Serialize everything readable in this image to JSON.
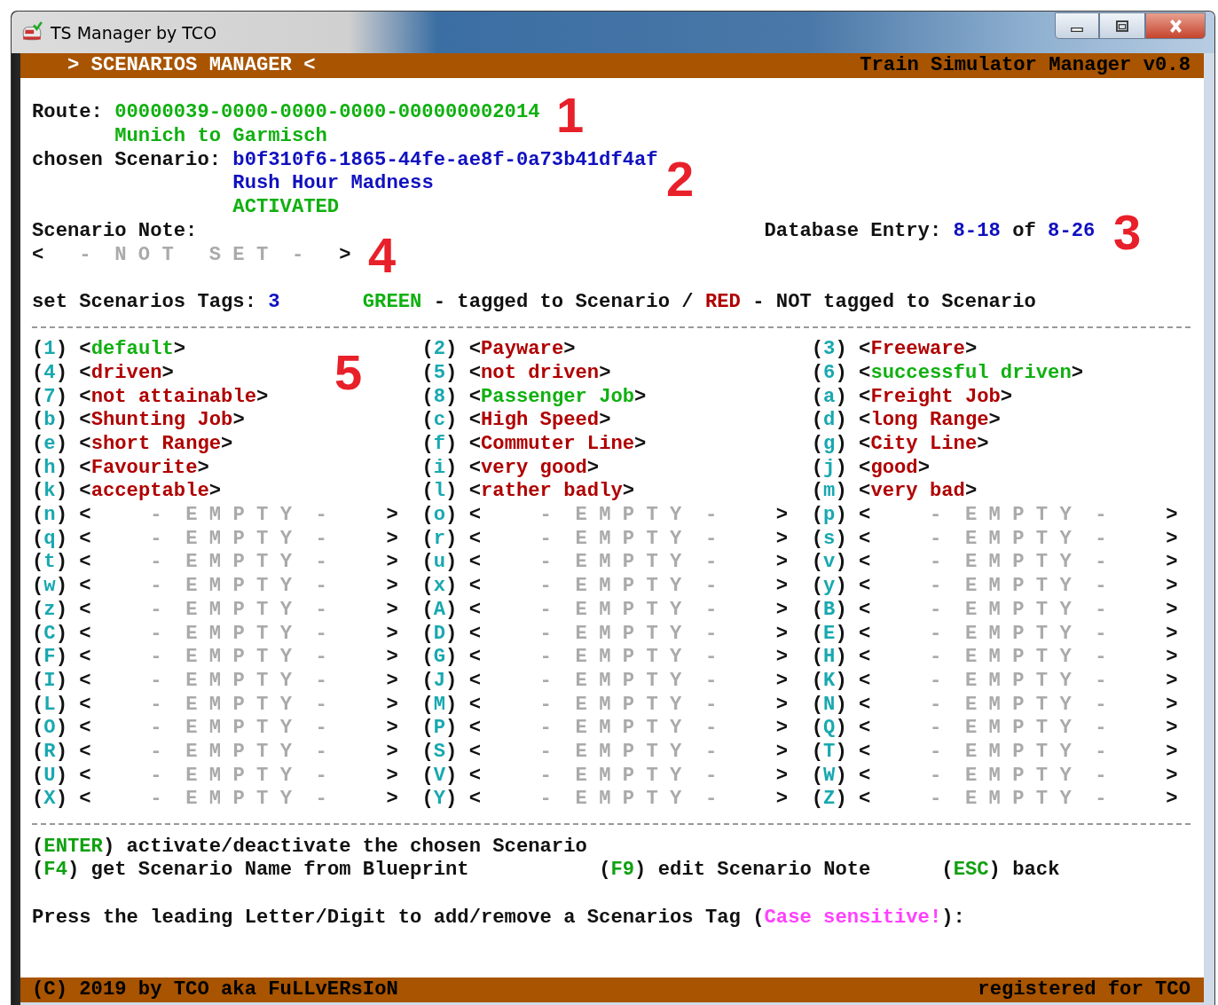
{
  "window": {
    "title": "TS Manager by TCO"
  },
  "header": {
    "left": "> SCENARIOS MANAGER <",
    "right": "Train Simulator Manager v0.8"
  },
  "route": {
    "label": "Route:",
    "id": "00000039-0000-0000-0000-000000002014",
    "name": "Munich to Garmisch"
  },
  "scenario": {
    "label": "chosen Scenario:",
    "id": "b0f310f6-1865-44fe-ae8f-0a73b41df4af",
    "name": "Rush Hour Madness",
    "status": "ACTIVATED",
    "activated": true
  },
  "note": {
    "label": "Scenario Note:",
    "open": "<",
    "text": "-  N O T   S E T  -",
    "close": ">",
    "set": false
  },
  "database": {
    "label": "Database Entry:",
    "current": "8-18",
    "of": "of",
    "total": "8-26"
  },
  "tags": {
    "label": "set Scenarios Tags:",
    "count": "3",
    "legend": [
      {
        "text": "GREEN",
        "kind": "ok"
      },
      {
        "text": " - tagged to Scenario / ",
        "kind": "plain"
      },
      {
        "text": "RED",
        "kind": "bad"
      },
      {
        "text": " - NOT tagged to Scenario",
        "kind": "plain"
      }
    ],
    "items": [
      {
        "key": [
          "(",
          "1",
          ")"
        ],
        "label": [
          "<",
          "default",
          ">"
        ],
        "tagged": true,
        "empty": false
      },
      {
        "key": [
          "(",
          "2",
          ")"
        ],
        "label": [
          "<",
          "Payware",
          ">"
        ],
        "tagged": false,
        "empty": false
      },
      {
        "key": [
          "(",
          "3",
          ")"
        ],
        "label": [
          "<",
          "Freeware",
          ">"
        ],
        "tagged": false,
        "empty": false
      },
      {
        "key": [
          "(",
          "4",
          ")"
        ],
        "label": [
          "<",
          "driven",
          ">"
        ],
        "tagged": false,
        "empty": false
      },
      {
        "key": [
          "(",
          "5",
          ")"
        ],
        "label": [
          "<",
          "not driven",
          ">"
        ],
        "tagged": false,
        "empty": false
      },
      {
        "key": [
          "(",
          "6",
          ")"
        ],
        "label": [
          "<",
          "successful driven",
          ">"
        ],
        "tagged": true,
        "empty": false
      },
      {
        "key": [
          "(",
          "7",
          ")"
        ],
        "label": [
          "<",
          "not attainable",
          ">"
        ],
        "tagged": false,
        "empty": false
      },
      {
        "key": [
          "(",
          "8",
          ")"
        ],
        "label": [
          "<",
          "Passenger Job",
          ">"
        ],
        "tagged": true,
        "empty": false
      },
      {
        "key": [
          "(",
          "a",
          ")"
        ],
        "label": [
          "<",
          "Freight Job",
          ">"
        ],
        "tagged": false,
        "empty": false
      },
      {
        "key": [
          "(",
          "b",
          ")"
        ],
        "label": [
          "<",
          "Shunting Job",
          ">"
        ],
        "tagged": false,
        "empty": false
      },
      {
        "key": [
          "(",
          "c",
          ")"
        ],
        "label": [
          "<",
          "High Speed",
          ">"
        ],
        "tagged": false,
        "empty": false
      },
      {
        "key": [
          "(",
          "d",
          ")"
        ],
        "label": [
          "<",
          "long Range",
          ">"
        ],
        "tagged": false,
        "empty": false
      },
      {
        "key": [
          "(",
          "e",
          ")"
        ],
        "label": [
          "<",
          "short Range",
          ">"
        ],
        "tagged": false,
        "empty": false
      },
      {
        "key": [
          "(",
          "f",
          ")"
        ],
        "label": [
          "<",
          "Commuter Line",
          ">"
        ],
        "tagged": false,
        "empty": false
      },
      {
        "key": [
          "(",
          "g",
          ")"
        ],
        "label": [
          "<",
          "City Line",
          ">"
        ],
        "tagged": false,
        "empty": false
      },
      {
        "key": [
          "(",
          "h",
          ")"
        ],
        "label": [
          "<",
          "Favourite",
          ">"
        ],
        "tagged": false,
        "empty": false
      },
      {
        "key": [
          "(",
          "i",
          ")"
        ],
        "label": [
          "<",
          "very good",
          ">"
        ],
        "tagged": false,
        "empty": false
      },
      {
        "key": [
          "(",
          "j",
          ")"
        ],
        "label": [
          "<",
          "good",
          ">"
        ],
        "tagged": false,
        "empty": false
      },
      {
        "key": [
          "(",
          "k",
          ")"
        ],
        "label": [
          "<",
          "acceptable",
          ">"
        ],
        "tagged": false,
        "empty": false
      },
      {
        "key": [
          "(",
          "l",
          ")"
        ],
        "label": [
          "<",
          "rather badly",
          ">"
        ],
        "tagged": false,
        "empty": false
      },
      {
        "key": [
          "(",
          "m",
          ")"
        ],
        "label": [
          "<",
          "very bad",
          ">"
        ],
        "tagged": false,
        "empty": false
      },
      {
        "key": [
          "(",
          "n",
          ")"
        ],
        "label": [
          "<",
          "-  E M P T Y  -",
          ">"
        ],
        "empty": true
      },
      {
        "key": [
          "(",
          "o",
          ")"
        ],
        "label": [
          "<",
          "-  E M P T Y  -",
          ">"
        ],
        "empty": true
      },
      {
        "key": [
          "(",
          "p",
          ")"
        ],
        "label": [
          "<",
          "-  E M P T Y  -",
          ">"
        ],
        "empty": true
      },
      {
        "key": [
          "(",
          "q",
          ")"
        ],
        "label": [
          "<",
          "-  E M P T Y  -",
          ">"
        ],
        "empty": true
      },
      {
        "key": [
          "(",
          "r",
          ")"
        ],
        "label": [
          "<",
          "-  E M P T Y  -",
          ">"
        ],
        "empty": true
      },
      {
        "key": [
          "(",
          "s",
          ")"
        ],
        "label": [
          "<",
          "-  E M P T Y  -",
          ">"
        ],
        "empty": true
      },
      {
        "key": [
          "(",
          "t",
          ")"
        ],
        "label": [
          "<",
          "-  E M P T Y  -",
          ">"
        ],
        "empty": true
      },
      {
        "key": [
          "(",
          "u",
          ")"
        ],
        "label": [
          "<",
          "-  E M P T Y  -",
          ">"
        ],
        "empty": true
      },
      {
        "key": [
          "(",
          "v",
          ")"
        ],
        "label": [
          "<",
          "-  E M P T Y  -",
          ">"
        ],
        "empty": true
      },
      {
        "key": [
          "(",
          "w",
          ")"
        ],
        "label": [
          "<",
          "-  E M P T Y  -",
          ">"
        ],
        "empty": true
      },
      {
        "key": [
          "(",
          "x",
          ")"
        ],
        "label": [
          "<",
          "-  E M P T Y  -",
          ">"
        ],
        "empty": true
      },
      {
        "key": [
          "(",
          "y",
          ")"
        ],
        "label": [
          "<",
          "-  E M P T Y  -",
          ">"
        ],
        "empty": true
      },
      {
        "key": [
          "(",
          "z",
          ")"
        ],
        "label": [
          "<",
          "-  E M P T Y  -",
          ">"
        ],
        "empty": true
      },
      {
        "key": [
          "(",
          "A",
          ")"
        ],
        "label": [
          "<",
          "-  E M P T Y  -",
          ">"
        ],
        "empty": true
      },
      {
        "key": [
          "(",
          "B",
          ")"
        ],
        "label": [
          "<",
          "-  E M P T Y  -",
          ">"
        ],
        "empty": true
      },
      {
        "key": [
          "(",
          "C",
          ")"
        ],
        "label": [
          "<",
          "-  E M P T Y  -",
          ">"
        ],
        "empty": true
      },
      {
        "key": [
          "(",
          "D",
          ")"
        ],
        "label": [
          "<",
          "-  E M P T Y  -",
          ">"
        ],
        "empty": true
      },
      {
        "key": [
          "(",
          "E",
          ")"
        ],
        "label": [
          "<",
          "-  E M P T Y  -",
          ">"
        ],
        "empty": true
      },
      {
        "key": [
          "(",
          "F",
          ")"
        ],
        "label": [
          "<",
          "-  E M P T Y  -",
          ">"
        ],
        "empty": true
      },
      {
        "key": [
          "(",
          "G",
          ")"
        ],
        "label": [
          "<",
          "-  E M P T Y  -",
          ">"
        ],
        "empty": true
      },
      {
        "key": [
          "(",
          "H",
          ")"
        ],
        "label": [
          "<",
          "-  E M P T Y  -",
          ">"
        ],
        "empty": true
      },
      {
        "key": [
          "(",
          "I",
          ")"
        ],
        "label": [
          "<",
          "-  E M P T Y  -",
          ">"
        ],
        "empty": true
      },
      {
        "key": [
          "(",
          "J",
          ")"
        ],
        "label": [
          "<",
          "-  E M P T Y  -",
          ">"
        ],
        "empty": true
      },
      {
        "key": [
          "(",
          "K",
          ")"
        ],
        "label": [
          "<",
          "-  E M P T Y  -",
          ">"
        ],
        "empty": true
      },
      {
        "key": [
          "(",
          "L",
          ")"
        ],
        "label": [
          "<",
          "-  E M P T Y  -",
          ">"
        ],
        "empty": true
      },
      {
        "key": [
          "(",
          "M",
          ")"
        ],
        "label": [
          "<",
          "-  E M P T Y  -",
          ">"
        ],
        "empty": true
      },
      {
        "key": [
          "(",
          "N",
          ")"
        ],
        "label": [
          "<",
          "-  E M P T Y  -",
          ">"
        ],
        "empty": true
      },
      {
        "key": [
          "(",
          "O",
          ")"
        ],
        "label": [
          "<",
          "-  E M P T Y  -",
          ">"
        ],
        "empty": true
      },
      {
        "key": [
          "(",
          "P",
          ")"
        ],
        "label": [
          "<",
          "-  E M P T Y  -",
          ">"
        ],
        "empty": true
      },
      {
        "key": [
          "(",
          "Q",
          ")"
        ],
        "label": [
          "<",
          "-  E M P T Y  -",
          ">"
        ],
        "empty": true
      },
      {
        "key": [
          "(",
          "R",
          ")"
        ],
        "label": [
          "<",
          "-  E M P T Y  -",
          ">"
        ],
        "empty": true
      },
      {
        "key": [
          "(",
          "S",
          ")"
        ],
        "label": [
          "<",
          "-  E M P T Y  -",
          ">"
        ],
        "empty": true
      },
      {
        "key": [
          "(",
          "T",
          ")"
        ],
        "label": [
          "<",
          "-  E M P T Y  -",
          ">"
        ],
        "empty": true
      },
      {
        "key": [
          "(",
          "U",
          ")"
        ],
        "label": [
          "<",
          "-  E M P T Y  -",
          ">"
        ],
        "empty": true
      },
      {
        "key": [
          "(",
          "V",
          ")"
        ],
        "label": [
          "<",
          "-  E M P T Y  -",
          ">"
        ],
        "empty": true
      },
      {
        "key": [
          "(",
          "W",
          ")"
        ],
        "label": [
          "<",
          "-  E M P T Y  -",
          ">"
        ],
        "empty": true
      },
      {
        "key": [
          "(",
          "X",
          ")"
        ],
        "label": [
          "<",
          "-  E M P T Y  -",
          ">"
        ],
        "empty": true
      },
      {
        "key": [
          "(",
          "Y",
          ")"
        ],
        "label": [
          "<",
          "-  E M P T Y  -",
          ">"
        ],
        "empty": true
      },
      {
        "key": [
          "(",
          "Z",
          ")"
        ],
        "label": [
          "<",
          "-  E M P T Y  -",
          ">"
        ],
        "empty": true
      }
    ]
  },
  "commands": [
    [
      {
        "key": [
          "(",
          "ENTER",
          ")"
        ],
        "text": "activate/deactivate the chosen Scenario"
      }
    ],
    [
      {
        "key": [
          "(",
          "F4",
          ")"
        ],
        "text": "get Scenario Name from Blueprint"
      },
      {
        "key": [
          "(",
          "F9",
          ")"
        ],
        "text": "edit Scenario Note"
      },
      {
        "key": [
          "(",
          "ESC",
          ")"
        ],
        "text": "back"
      }
    ]
  ],
  "prompt": [
    {
      "text": "Press the leading Letter/Digit to add/remove a Scenarios Tag (",
      "kind": "plain"
    },
    {
      "text": "Case sensitive!",
      "kind": "highlight"
    },
    {
      "text": "):",
      "kind": "plain"
    }
  ],
  "footer": {
    "left": "(C) 2019 by TCO aka FuLLvERsIoN",
    "right": "registered for TCO"
  },
  "annotations": [
    "1",
    "2",
    "3",
    "4",
    "5"
  ]
}
